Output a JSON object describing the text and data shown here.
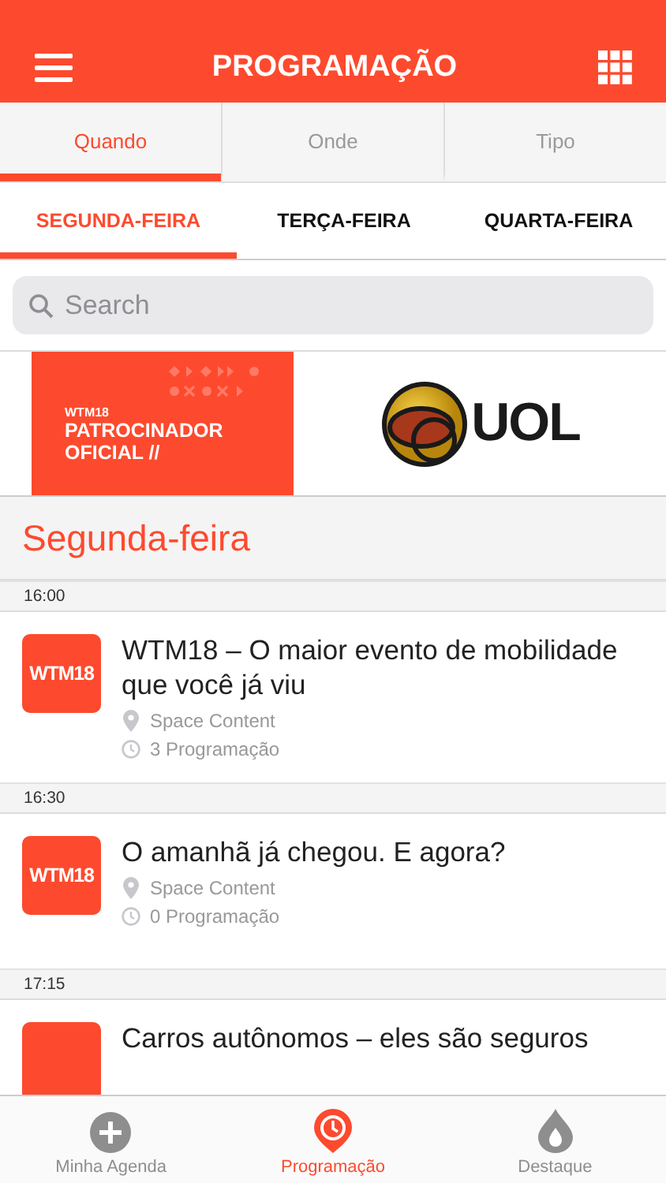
{
  "header": {
    "title": "PROGRAMAÇÃO"
  },
  "tabs": [
    {
      "label": "Quando",
      "selected": true
    },
    {
      "label": "Onde",
      "selected": false
    },
    {
      "label": "Tipo",
      "selected": false
    }
  ],
  "days": [
    {
      "label": "SEGUNDA-FEIRA",
      "selected": true
    },
    {
      "label": "TERÇA-FEIRA",
      "selected": false
    },
    {
      "label": "QUARTA-FEIRA",
      "selected": false
    }
  ],
  "search": {
    "placeholder": "Search"
  },
  "banner": {
    "small": "WTM18",
    "headline": "PATROCINADOR OFICIAL //",
    "sponsor": "UOL"
  },
  "section_title": "Segunda-feira",
  "sessions": [
    {
      "time": "16:00",
      "thumb": "WTM18",
      "title": "WTM18 – O maior evento de mobilidade que você já viu",
      "place": "Space Content",
      "count": "3 Programação"
    },
    {
      "time": "16:30",
      "thumb": "WTM18",
      "title": "O amanhã já chegou. E agora?",
      "place": "Space Content",
      "count": "0 Programação"
    },
    {
      "time": "17:15",
      "title": "Carros autônomos – eles são seguros"
    }
  ],
  "bottom_nav": [
    {
      "label": "Minha Agenda",
      "kind": "plus",
      "selected": false
    },
    {
      "label": "Programação",
      "kind": "clock-pin",
      "selected": true
    },
    {
      "label": "Destaque",
      "kind": "drop",
      "selected": false
    }
  ]
}
